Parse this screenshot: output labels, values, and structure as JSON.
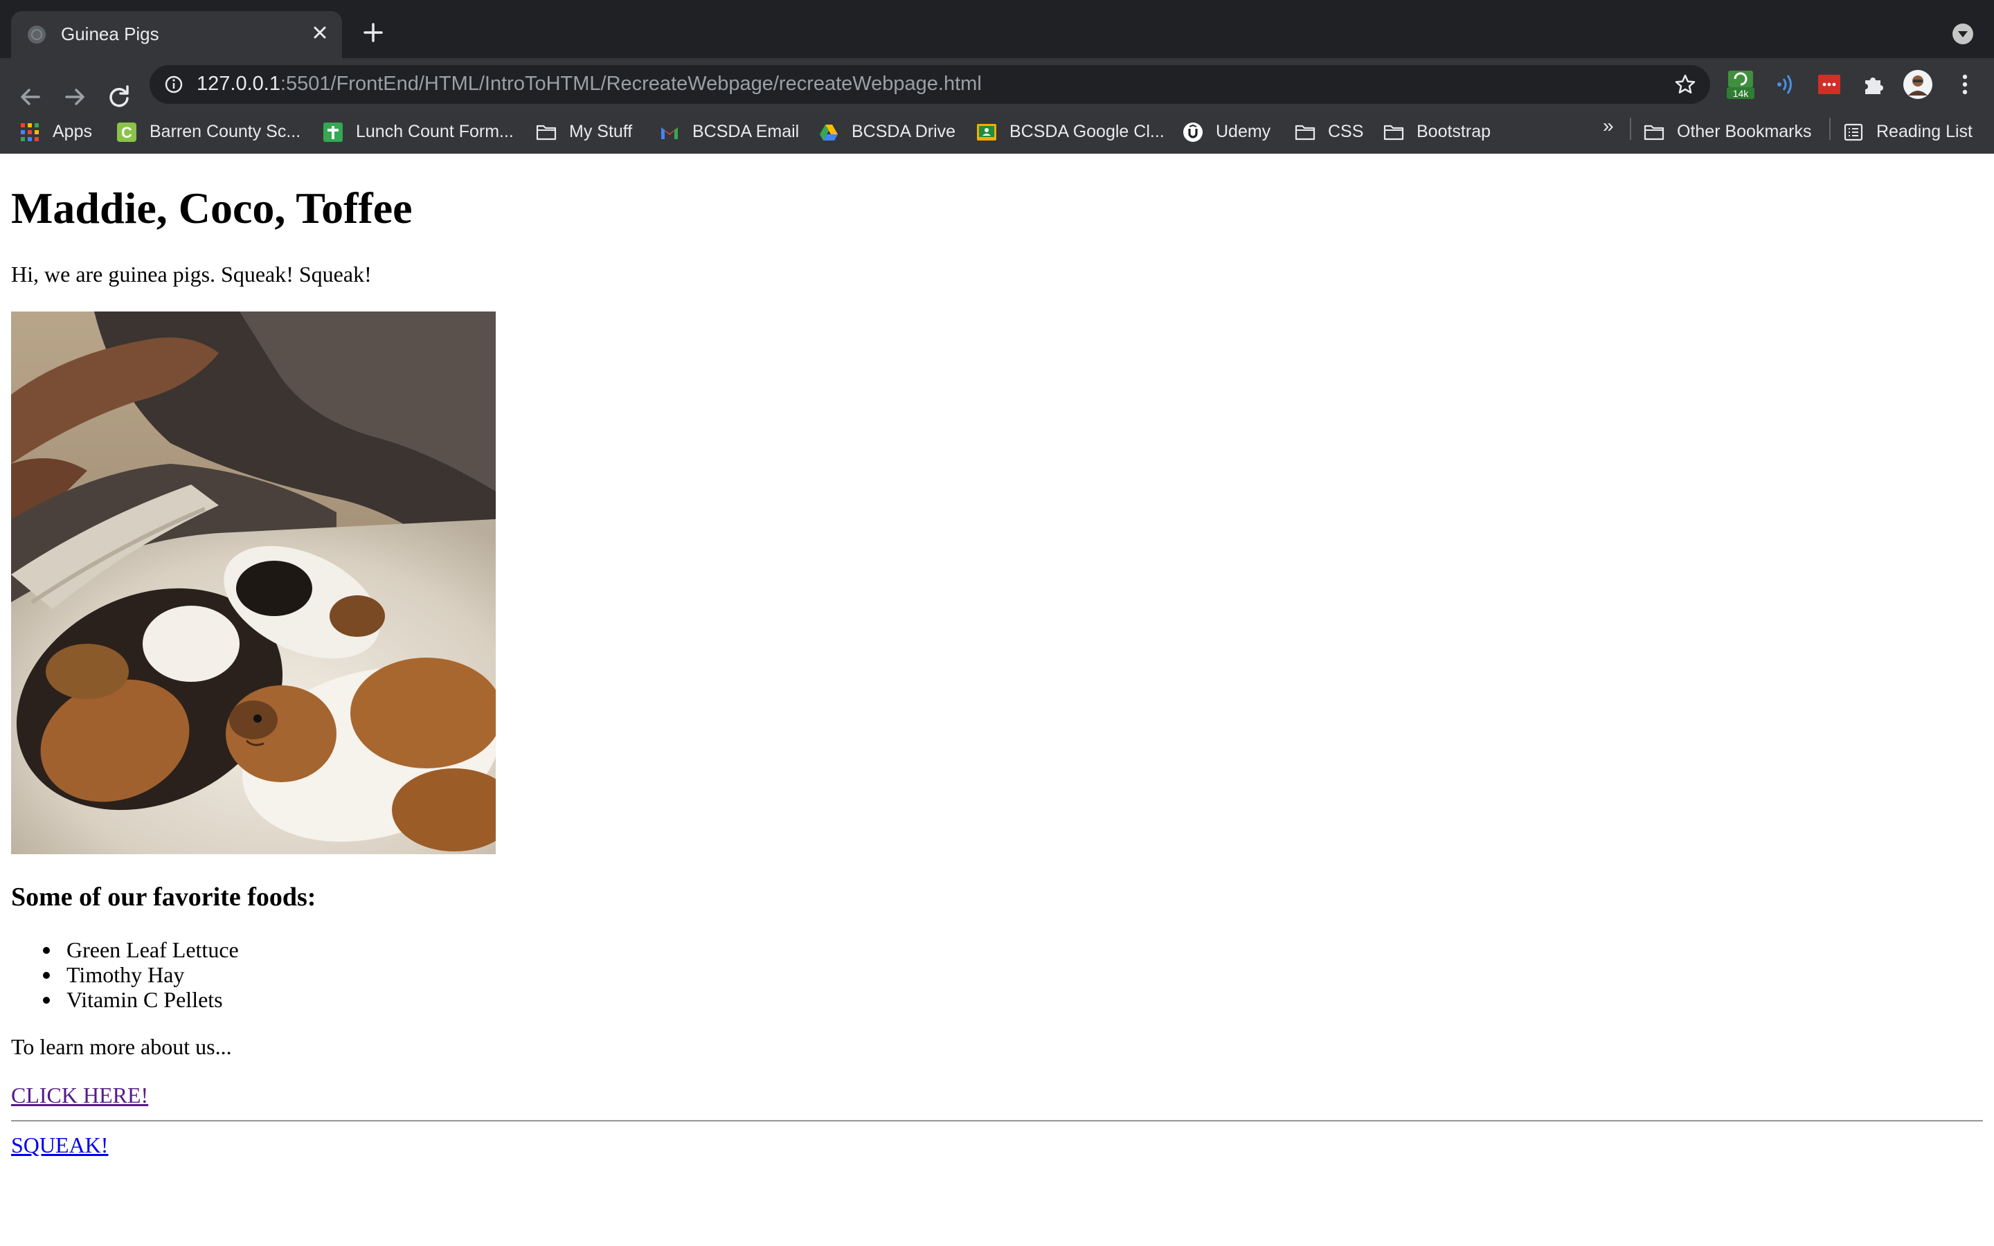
{
  "browser": {
    "tab_title": "Guinea Pigs",
    "url_host": "127.0.0.1",
    "url_rest": ":5501/FrontEnd/HTML/IntroToHTML/RecreateWebpage/recreateWebpage.html",
    "extension_badge": "14k"
  },
  "bookmarks": [
    {
      "label": "Apps",
      "icon": "apps-grid-icon"
    },
    {
      "label": "Barren County Sc...",
      "icon": "classroom-c-icon"
    },
    {
      "label": "Lunch Count Form...",
      "icon": "forms-plus-icon"
    },
    {
      "label": "My Stuff",
      "icon": "folder-icon"
    },
    {
      "label": "BCSDA Email",
      "icon": "gmail-icon"
    },
    {
      "label": "BCSDA Drive",
      "icon": "drive-icon"
    },
    {
      "label": "BCSDA Google Cl...",
      "icon": "google-classroom-icon"
    },
    {
      "label": "Udemy",
      "icon": "udemy-icon"
    },
    {
      "label": "CSS",
      "icon": "folder-icon"
    },
    {
      "label": "Bootstrap",
      "icon": "folder-icon"
    }
  ],
  "bookmarks_more": "»",
  "other_bookmarks": "Other Bookmarks",
  "reading_list": "Reading List",
  "page": {
    "heading": "Maddie, Coco, Toffee",
    "intro": "Hi, we are guinea pigs. Squeak! Squeak!",
    "foods_heading": "Some of our favorite foods:",
    "foods": [
      "Green Leaf Lettuce",
      "Timothy Hay",
      "Vitamin C Pellets"
    ],
    "learn_more": "To learn more about us...",
    "link_visited": "CLICK HERE!",
    "link_squeak": "SQUEAK!"
  }
}
